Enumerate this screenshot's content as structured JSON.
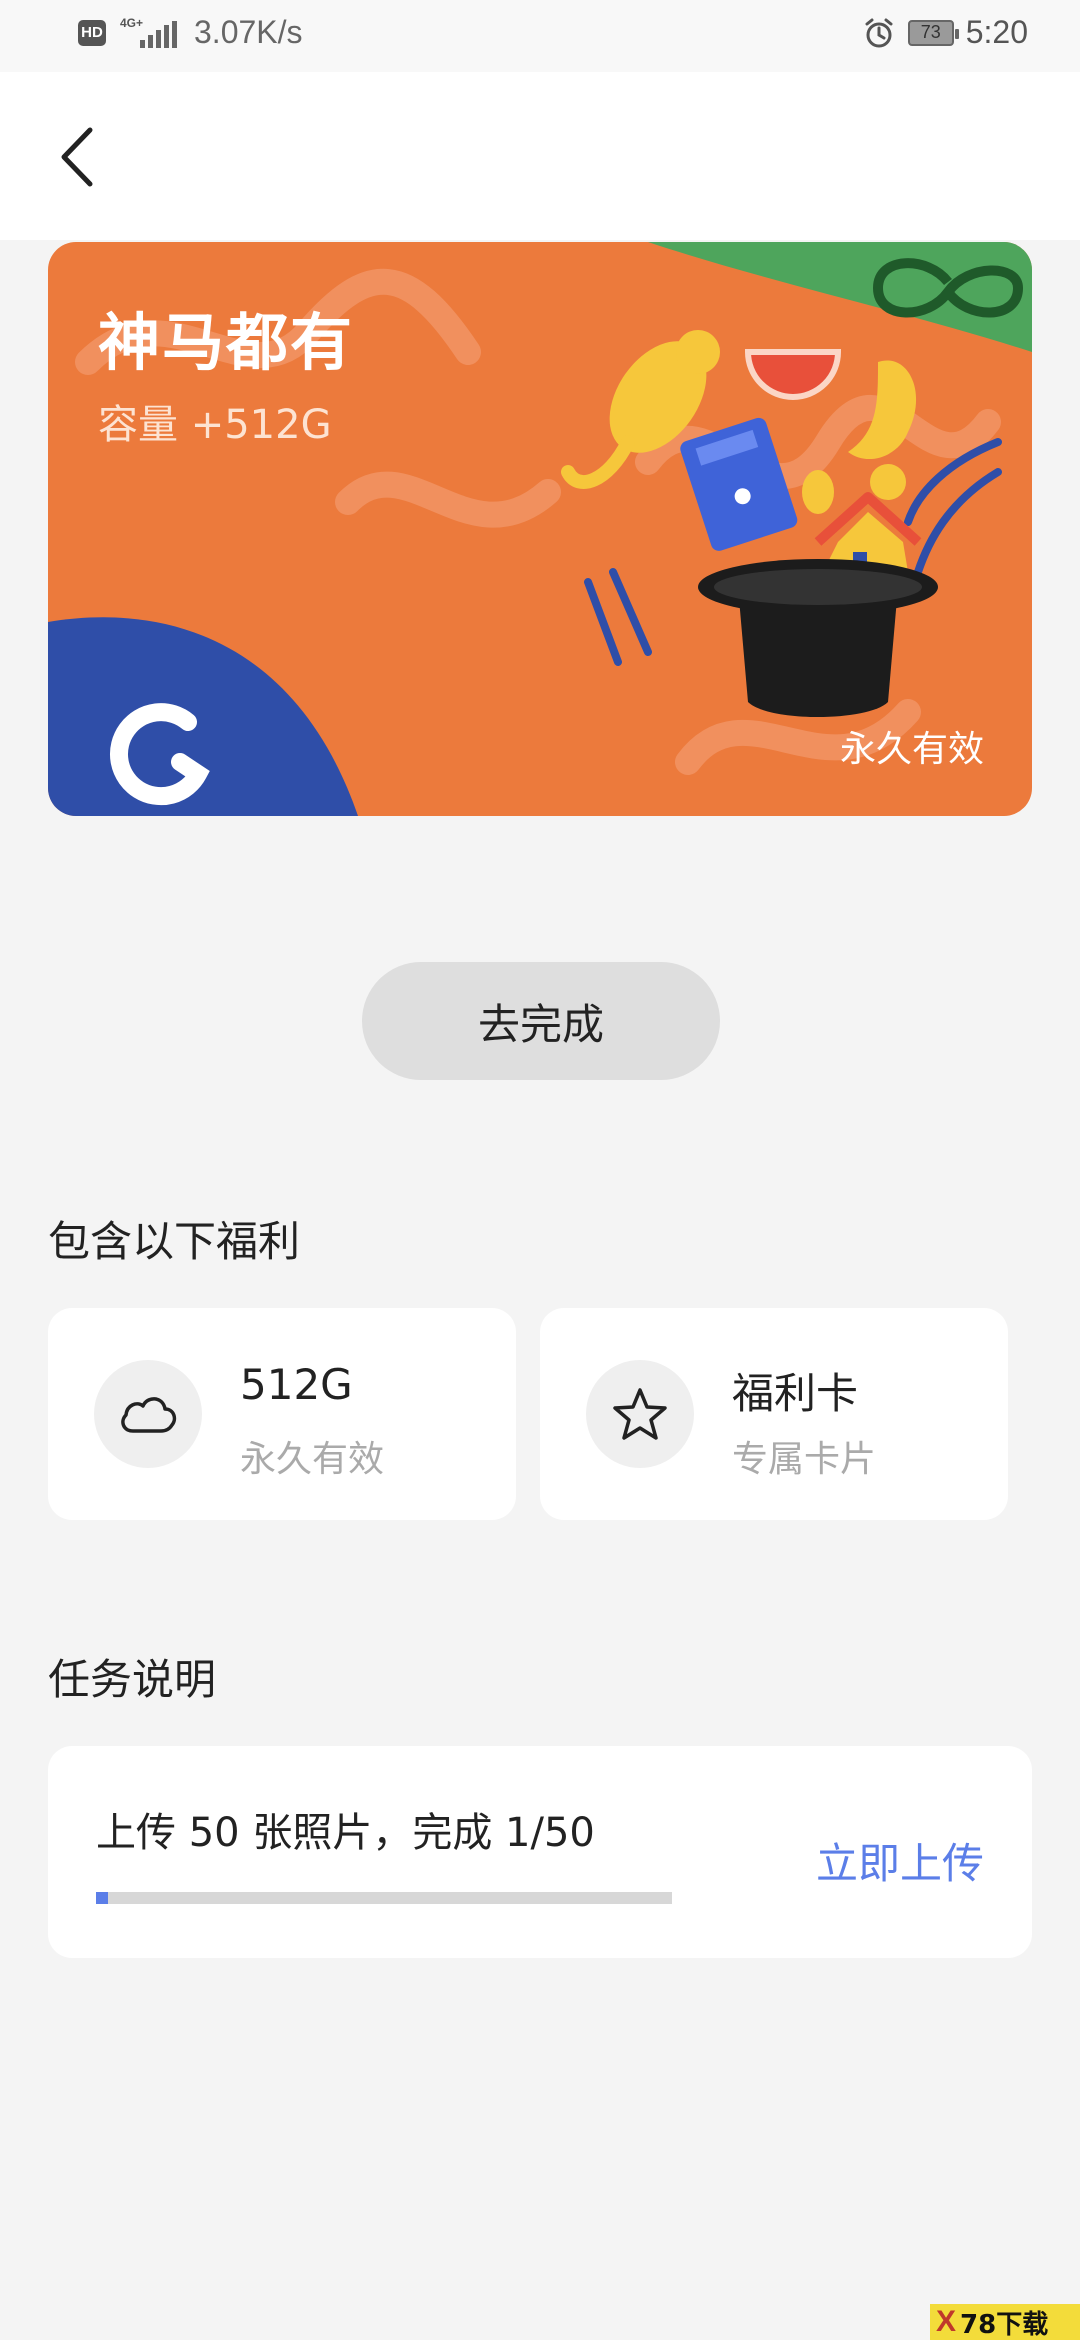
{
  "status_bar": {
    "hd": "HD",
    "network": "4G+",
    "net_speed": "3.07K/s",
    "battery": "73",
    "time": "5:20"
  },
  "header": {
    "back_icon": "chevron-left-icon"
  },
  "hero": {
    "title": "神马都有",
    "capacity": "容量 +512G",
    "validity": "永久有效",
    "colors": {
      "orange": "#ec7a3c",
      "green": "#4ea55c",
      "blue": "#2f4ea8"
    }
  },
  "actions": {
    "go_complete": "去完成"
  },
  "benefits": {
    "title": "包含以下福利",
    "items": [
      {
        "icon": "cloud-icon",
        "name": "512G",
        "desc": "永久有效"
      },
      {
        "icon": "star-icon",
        "name": "福利卡",
        "desc": "专属卡片"
      }
    ]
  },
  "task": {
    "title": "任务说明",
    "description": "上传 50 张照片，完成 1/50",
    "progress": 0.02,
    "action": "立即上传",
    "accent": "#5b7ee8"
  },
  "watermark": {
    "mark": "X",
    "text": "78下载"
  }
}
